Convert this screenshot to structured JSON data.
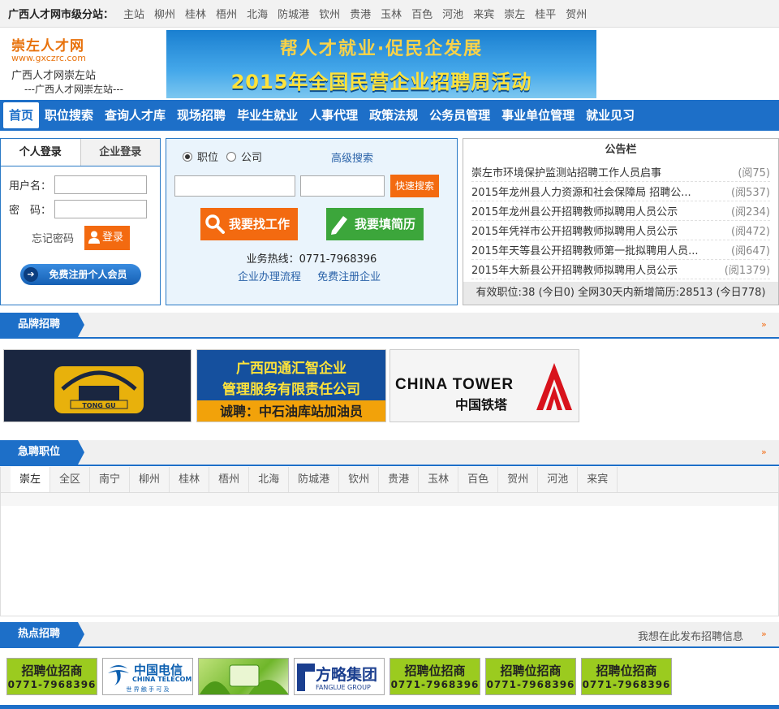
{
  "topbar": {
    "lead": "广西人才网市级分站：",
    "cities": [
      "主站",
      "柳州",
      "桂林",
      "梧州",
      "北海",
      "防城港",
      "钦州",
      "贵港",
      "玉林",
      "百色",
      "河池",
      "来宾",
      "崇左",
      "桂平",
      "贺州"
    ]
  },
  "logo": {
    "name": "崇左人才网",
    "domain": "www.gxczrc.com",
    "site": "广西人才网崇左站",
    "sub": "---广西人才网崇左站---"
  },
  "banner": {
    "line1": "帮人才就业·促民企发展",
    "line2": "2015年全国民营企业招聘周活动"
  },
  "nav": [
    "首页",
    "职位搜索",
    "查询人才库",
    "现场招聘",
    "毕业生就业",
    "人事代理",
    "政策法规",
    "公务员管理",
    "事业单位管理",
    "就业见习"
  ],
  "login": {
    "tab_person": "个人登录",
    "tab_company": "企业登录",
    "username_label": "用户名：",
    "password_label": "密　码：",
    "forgot": "忘记密码",
    "login_btn": "登录",
    "register_btn": "免费注册个人会员"
  },
  "search": {
    "radio_job": "职位",
    "radio_company": "公司",
    "advanced": "高级搜索",
    "quick_btn": "快速搜索",
    "find_job": "我要找工作",
    "fill_resume": "我要填简历",
    "hotline": "业务热线：0771-7968396",
    "link_process": "企业办理流程",
    "link_register": "免费注册企业"
  },
  "notice": {
    "title": "公告栏",
    "items": [
      {
        "title": "崇左市环境保护监测站招聘工作人员启事",
        "reads": "(阅75)"
      },
      {
        "title": "2015年龙州县人力资源和社会保障局 招聘公...",
        "reads": "(阅537)"
      },
      {
        "title": "2015年龙州县公开招聘教师拟聘用人员公示",
        "reads": "(阅234)"
      },
      {
        "title": "2015年凭祥市公开招聘教师拟聘用人员公示",
        "reads": "(阅472)"
      },
      {
        "title": "2015年天等县公开招聘教师第一批拟聘用人员...",
        "reads": "(阅647)"
      },
      {
        "title": "2015年大新县公开招聘教师拟聘用人员公示",
        "reads": "(阅1379)"
      }
    ],
    "footer": "有效职位:38 (今日0) 全网30天内新增简历:28513 (今日778)"
  },
  "brand": {
    "title": "品牌招聘",
    "tonggu": "TONG GU",
    "sitong_l1": "广西四通汇智企业",
    "sitong_l2": "管理服务有限责任公司",
    "sitong_l3": "诚聘：中石油库站加油员",
    "tower_en": "CHINA TOWER",
    "tower_cn": "中国铁塔"
  },
  "urgent": {
    "title": "急聘职位",
    "cities": [
      "崇左",
      "全区",
      "南宁",
      "柳州",
      "桂林",
      "梧州",
      "北海",
      "防城港",
      "钦州",
      "贵港",
      "玉林",
      "百色",
      "贺州",
      "河池",
      "来宾"
    ]
  },
  "hot": {
    "title": "热点招聘",
    "post_link": "我想在此发布招聘信息",
    "ad_title": "招聘位招商",
    "ad_phone": "0771-7968396",
    "telecom_cn": "中国电信",
    "telecom_en": "CHINA TELECOM",
    "telecom_slogan": "世 界 触 手 可 及",
    "fanglue_cn": "方略集团",
    "fanglue_en": "FANGLUE GROUP"
  },
  "colors": {
    "brand_blue": "#1d6fc8",
    "accent_orange": "#f36a10",
    "green": "#3ca63b"
  }
}
